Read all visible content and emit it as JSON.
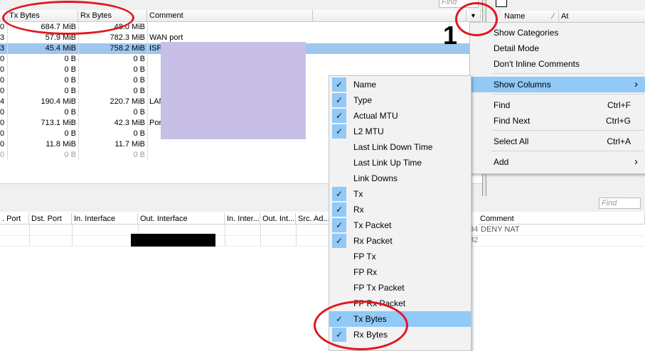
{
  "top_table": {
    "headers": {
      "tx": "Tx Bytes",
      "rx": "Rx Bytes",
      "comment": "Comment"
    },
    "rows": [
      {
        "lead": "0",
        "tx": "684.7 MiB",
        "rx": "48.0 MiB",
        "comment": "",
        "selected": false,
        "dim": false
      },
      {
        "lead": "3",
        "tx": "57.9 MiB",
        "rx": "782.3 MiB",
        "comment": "WAN port",
        "selected": false,
        "dim": false
      },
      {
        "lead": "3",
        "tx": "45.4 MiB",
        "rx": "758.2 MiB",
        "comment": "ISP",
        "selected": true,
        "dim": false
      },
      {
        "lead": "0",
        "tx": "0 B",
        "rx": "0 B",
        "comment": "",
        "selected": false,
        "dim": false
      },
      {
        "lead": "0",
        "tx": "0 B",
        "rx": "0 B",
        "comment": "",
        "selected": false,
        "dim": false
      },
      {
        "lead": "0",
        "tx": "0 B",
        "rx": "0 B",
        "comment": "",
        "selected": false,
        "dim": false
      },
      {
        "lead": "0",
        "tx": "0 B",
        "rx": "0 B",
        "comment": "",
        "selected": false,
        "dim": false
      },
      {
        "lead": "4",
        "tx": "190.4 MiB",
        "rx": "220.7 MiB",
        "comment": "LAN",
        "selected": false,
        "dim": false
      },
      {
        "lead": "0",
        "tx": "0 B",
        "rx": "0 B",
        "comment": "",
        "selected": false,
        "dim": false
      },
      {
        "lead": "0",
        "tx": "713.1 MiB",
        "rx": "42.3 MiB",
        "comment": "Port",
        "selected": false,
        "dim": false
      },
      {
        "lead": "0",
        "tx": "0 B",
        "rx": "0 B",
        "comment": "",
        "selected": false,
        "dim": false
      },
      {
        "lead": "0",
        "tx": "11.8 MiB",
        "rx": "11.7 MiB",
        "comment": "",
        "selected": false,
        "dim": false
      },
      {
        "lead": "0",
        "tx": "0 B",
        "rx": "0 B",
        "comment": "",
        "selected": false,
        "dim": true
      }
    ]
  },
  "find_placeholder": "Find",
  "right_pane": {
    "col_name": "Name",
    "col_at": "At",
    "find_placeholder": "Find"
  },
  "annotation_number": "1",
  "main_menu": {
    "items": [
      {
        "label": "Show Categories",
        "shortcut": "",
        "submenu": false
      },
      {
        "label": "Detail Mode",
        "shortcut": "",
        "submenu": false
      },
      {
        "label": "Don't Inline Comments",
        "shortcut": "",
        "submenu": false
      },
      {
        "label": "Show Columns",
        "shortcut": "",
        "submenu": true,
        "highlighted": true
      },
      {
        "label": "Find",
        "shortcut": "Ctrl+F",
        "submenu": false
      },
      {
        "label": "Find Next",
        "shortcut": "Ctrl+G",
        "submenu": false
      },
      {
        "label": "Select All",
        "shortcut": "Ctrl+A",
        "submenu": false
      },
      {
        "label": "Add",
        "shortcut": "",
        "submenu": true
      }
    ]
  },
  "columns_menu": {
    "items": [
      {
        "label": "Name",
        "checked": true
      },
      {
        "label": "Type",
        "checked": true
      },
      {
        "label": "Actual MTU",
        "checked": true
      },
      {
        "label": "L2 MTU",
        "checked": true
      },
      {
        "label": "Last Link Down Time",
        "checked": false
      },
      {
        "label": "Last Link Up Time",
        "checked": false
      },
      {
        "label": "Link Downs",
        "checked": false
      },
      {
        "label": "Tx",
        "checked": true
      },
      {
        "label": "Rx",
        "checked": true
      },
      {
        "label": "Tx Packet",
        "checked": true
      },
      {
        "label": "Rx Packet",
        "checked": true
      },
      {
        "label": "FP Tx",
        "checked": false
      },
      {
        "label": "FP Rx",
        "checked": false
      },
      {
        "label": "FP Tx Packet",
        "checked": false
      },
      {
        "label": "FP Rx Packet",
        "checked": false
      },
      {
        "label": "Tx Bytes",
        "checked": true,
        "highlighted": true
      },
      {
        "label": "Rx Bytes",
        "checked": true
      }
    ]
  },
  "bottom_table": {
    "headers": [
      ". Port",
      "Dst. Port",
      "In. Interface",
      "Out. Interface",
      "In. Inter...",
      "Out. Int...",
      "Src. Ad..."
    ],
    "comment_header": "Comment",
    "rows": [
      {
        "tail": "34",
        "comment": "DENY NAT"
      },
      {
        "tail": "32",
        "comment": ""
      }
    ]
  },
  "colors": {
    "selection": "#9ec6ee",
    "menu_highlight": "#91c9f7",
    "annotation_red": "#e0181f",
    "redaction_purple": "#c7bfe6",
    "redaction_black": "#000000"
  }
}
